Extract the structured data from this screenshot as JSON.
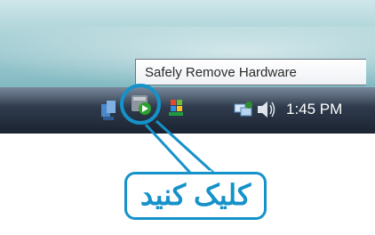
{
  "tooltip": {
    "text": "Safely Remove Hardware"
  },
  "taskbar": {
    "clock": "1:45 PM",
    "icons": [
      "network-share-icon",
      "safely-remove-hardware-icon",
      "colorful-flag-icon",
      "network-icon",
      "volume-icon"
    ]
  },
  "callout": {
    "text": "کلیک کنید",
    "accent_color": "#1592c9"
  }
}
